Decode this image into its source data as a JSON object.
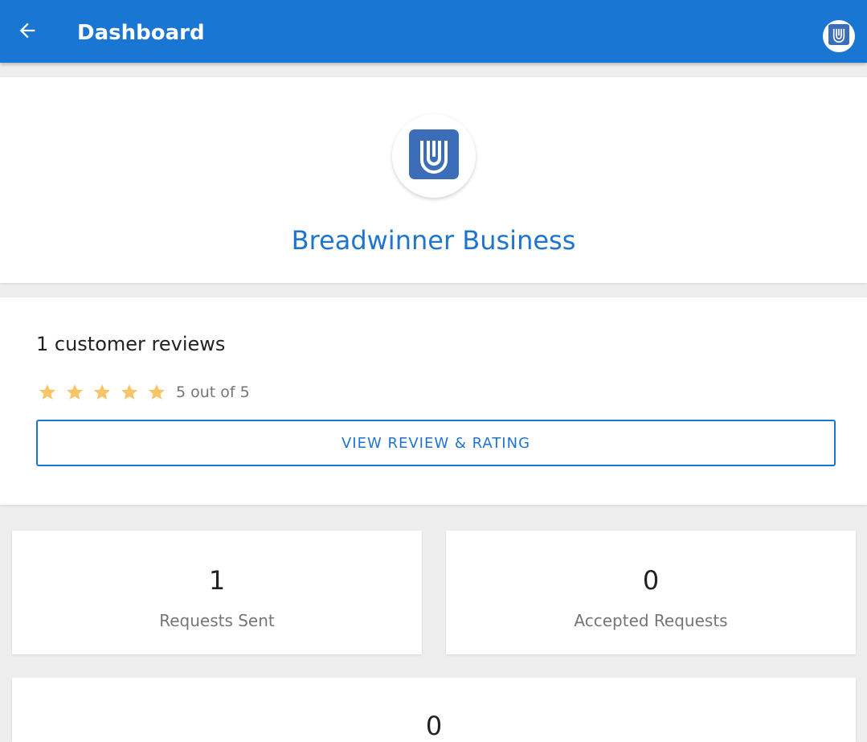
{
  "appbar": {
    "title": "Dashboard",
    "back_icon": "arrow-left-icon",
    "avatar_icon": "breadwinner-logo-icon",
    "color": "#1976d2"
  },
  "profile": {
    "business_name": "Breadwinner Business",
    "logo_icon": "breadwinner-logo-icon",
    "name_color": "#1f74cf"
  },
  "reviews": {
    "count_text": "1 customer reviews",
    "rating_value": 5,
    "rating_max": 5,
    "rating_text": "5 out of 5",
    "star_icon": "star-icon",
    "star_color": "#f7c565",
    "button_label": "VIEW REVIEW & RATING"
  },
  "stats": [
    {
      "value": "1",
      "label": "Requests Sent"
    },
    {
      "value": "0",
      "label": "Accepted Requests"
    },
    {
      "value": "0",
      "label": ""
    }
  ]
}
